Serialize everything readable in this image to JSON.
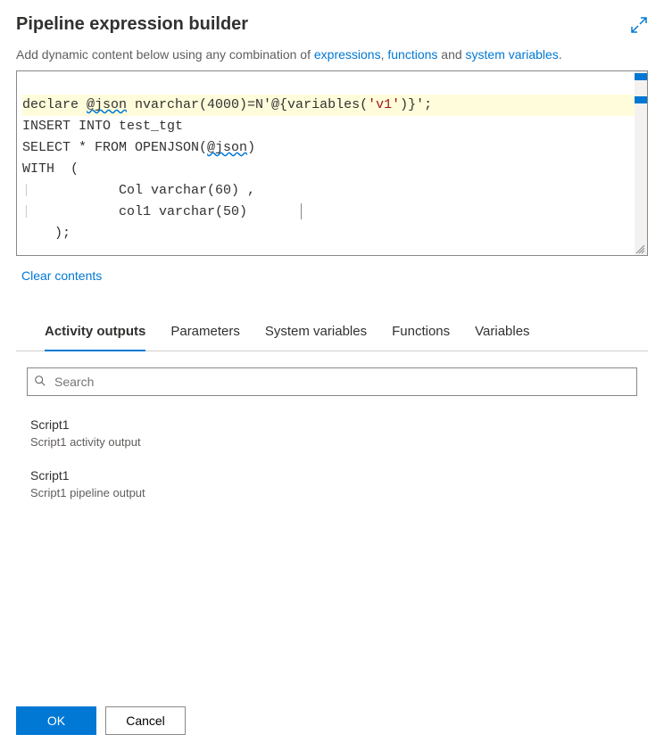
{
  "header": {
    "title": "Pipeline expression builder"
  },
  "help": {
    "prefix": "Add dynamic content below using any combination of ",
    "link1": "expressions",
    "sep1": ", ",
    "link2": "functions",
    "sep2": " and ",
    "link3": "system variables",
    "suffix": "."
  },
  "editor": {
    "line1_a": "declare ",
    "line1_b": "@json",
    "line1_c": " nvarchar(4000)=N'@{variables(",
    "line1_d": "'v1'",
    "line1_e": ")}';",
    "line2": "INSERT INTO test_tgt",
    "line3_a": "SELECT * FROM OPENJSON(",
    "line3_b": "@json",
    "line3_c": ")",
    "line4": "WITH  (",
    "line5": "        Col varchar(60) ,",
    "line6": "        col1 varchar(50)",
    "line7": "    );"
  },
  "clear_label": "Clear contents",
  "tabs": {
    "activity_outputs": "Activity outputs",
    "parameters": "Parameters",
    "system_variables": "System variables",
    "functions": "Functions",
    "variables": "Variables"
  },
  "search": {
    "placeholder": "Search"
  },
  "outputs": [
    {
      "title": "Script1",
      "sub": "Script1 activity output"
    },
    {
      "title": "Script1",
      "sub": "Script1 pipeline output"
    }
  ],
  "footer": {
    "ok": "OK",
    "cancel": "Cancel"
  }
}
